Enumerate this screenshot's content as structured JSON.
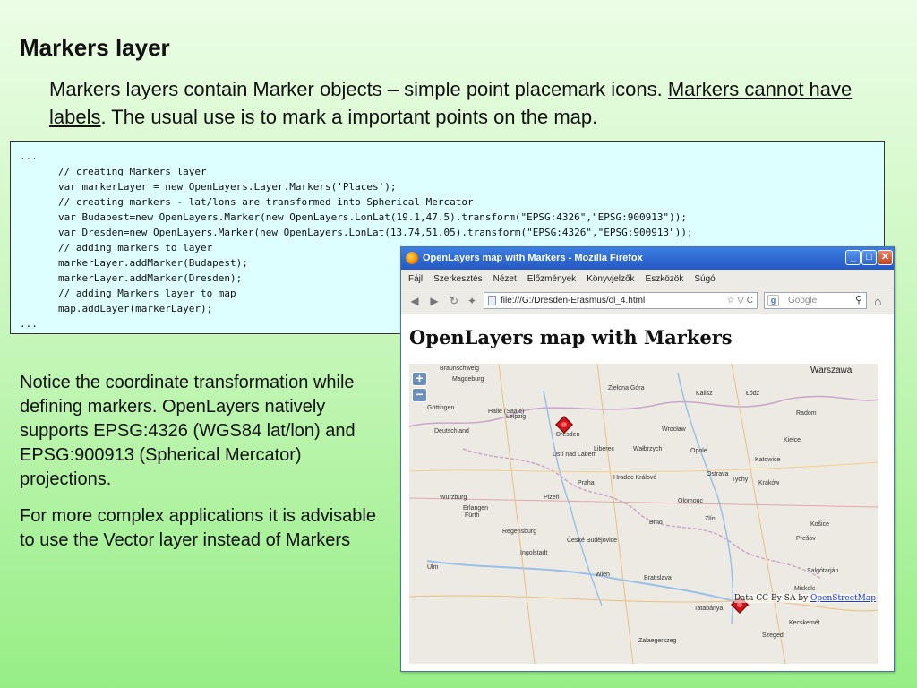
{
  "slide": {
    "title": "Markers layer",
    "intro_before": "Markers layers contain Marker objects – simple point placemark icons. ",
    "intro_underlined": "Markers cannot have labels",
    "intro_after": ". The usual use is to mark a important points on the map."
  },
  "code": {
    "lines": [
      {
        "text": "...",
        "indent": false
      },
      {
        "text": "// creating Markers layer",
        "indent": true
      },
      {
        "text": "var markerLayer = new OpenLayers.Layer.Markers('Places');",
        "indent": true
      },
      {
        "text": "// creating markers - lat/lons are transformed into Spherical Mercator",
        "indent": true
      },
      {
        "text": "var Budapest=new OpenLayers.Marker(new OpenLayers.LonLat(19.1,47.5).transform(\"EPSG:4326\",\"EPSG:900913\"));",
        "indent": true
      },
      {
        "text": "var Dresden=new OpenLayers.Marker(new OpenLayers.LonLat(13.74,51.05).transform(\"EPSG:4326\",\"EPSG:900913\"));",
        "indent": true
      },
      {
        "text": "// adding markers to layer",
        "indent": true
      },
      {
        "text": "markerLayer.addMarker(Budapest);",
        "indent": true
      },
      {
        "text": "markerLayer.addMarker(Dresden);",
        "indent": true
      },
      {
        "text": "// adding Markers layer to map",
        "indent": true
      },
      {
        "text": "map.addLayer(markerLayer);",
        "indent": true
      },
      {
        "text": "...",
        "indent": false
      }
    ]
  },
  "notes": {
    "p1": "Notice the coordinate transformation while defining markers. OpenLayers natively supports EPSG:4326 (WGS84 lat/lon) and EPSG:900913 (Spherical Mercator) projections.",
    "p2": "For more complex applications it is advisable to use the Vector layer instead of Markers"
  },
  "browser": {
    "window_title": "OpenLayers map with Markers - Mozilla Firefox",
    "window_buttons": {
      "minimize": "_",
      "maximize": "□",
      "close": "✕"
    },
    "menu": [
      "Fájl",
      "Szerkesztés",
      "Nézet",
      "Előzmények",
      "Könyvjelzők",
      "Eszközök",
      "Súgó"
    ],
    "nav": {
      "back": "◀",
      "forward": "▶",
      "reload": "↻",
      "stop": "✦"
    },
    "address": "file:///G:/Dresden-Erasmus/ol_4.html",
    "address_controls": "☆ ▽ C",
    "search_placeholder": "Google",
    "search_logo": "g",
    "icons": {
      "search": "⚲",
      "home": "⌂"
    },
    "page_heading": "OpenLayers map with Markers",
    "map": {
      "zoom_in": "+",
      "zoom_out": "−",
      "cities": [
        {
          "name": "Braunschweig",
          "big": false
        },
        {
          "name": "Magdeburg",
          "big": false
        },
        {
          "name": "Zielona Góra",
          "big": false
        },
        {
          "name": "Warszawa",
          "big": true
        },
        {
          "name": "Kalisz",
          "big": false
        },
        {
          "name": "Łódź",
          "big": false
        },
        {
          "name": "Göttingen",
          "big": false
        },
        {
          "name": "Halle (Saale)",
          "big": false
        },
        {
          "name": "Leipzig",
          "big": false
        },
        {
          "name": "Wrocław",
          "big": false
        },
        {
          "name": "Radom",
          "big": false
        },
        {
          "name": "Deutschland",
          "big": false
        },
        {
          "name": "Dresden",
          "big": false
        },
        {
          "name": "Liberec",
          "big": false
        },
        {
          "name": "Wałbrzych",
          "big": false
        },
        {
          "name": "Opole",
          "big": false
        },
        {
          "name": "Kielce",
          "big": false
        },
        {
          "name": "Ústí nad Labem",
          "big": false
        },
        {
          "name": "Katowice",
          "big": false
        },
        {
          "name": "Praha",
          "big": false
        },
        {
          "name": "Hradec Králové",
          "big": false
        },
        {
          "name": "Ostrava",
          "big": false
        },
        {
          "name": "Kraków",
          "big": false
        },
        {
          "name": "Tychy",
          "big": false
        },
        {
          "name": "Würzburg",
          "big": false
        },
        {
          "name": "Plzeň",
          "big": false
        },
        {
          "name": "Olomouc",
          "big": false
        },
        {
          "name": "Erlangen",
          "big": false
        },
        {
          "name": "Fürth",
          "big": false
        },
        {
          "name": "Regensburg",
          "big": false
        },
        {
          "name": "Brno",
          "big": false
        },
        {
          "name": "České Budějovice",
          "big": false
        },
        {
          "name": "Zlín",
          "big": false
        },
        {
          "name": "Prešov",
          "big": false
        },
        {
          "name": "Košice",
          "big": false
        },
        {
          "name": "Bratislava",
          "big": false
        },
        {
          "name": "Wien",
          "big": false
        },
        {
          "name": "Salgótarján",
          "big": false
        },
        {
          "name": "Miskolc",
          "big": false
        },
        {
          "name": "Tatabánya",
          "big": false
        },
        {
          "name": "Szeged",
          "big": false
        },
        {
          "name": "Kecskemét",
          "big": false
        },
        {
          "name": "Zalaegerszeg",
          "big": false
        },
        {
          "name": "Ulm",
          "big": false
        },
        {
          "name": "Ingolstadt",
          "big": false
        }
      ],
      "attribution_prefix": "Data CC-By-SA by ",
      "attribution_link": "OpenStreetMap"
    }
  }
}
